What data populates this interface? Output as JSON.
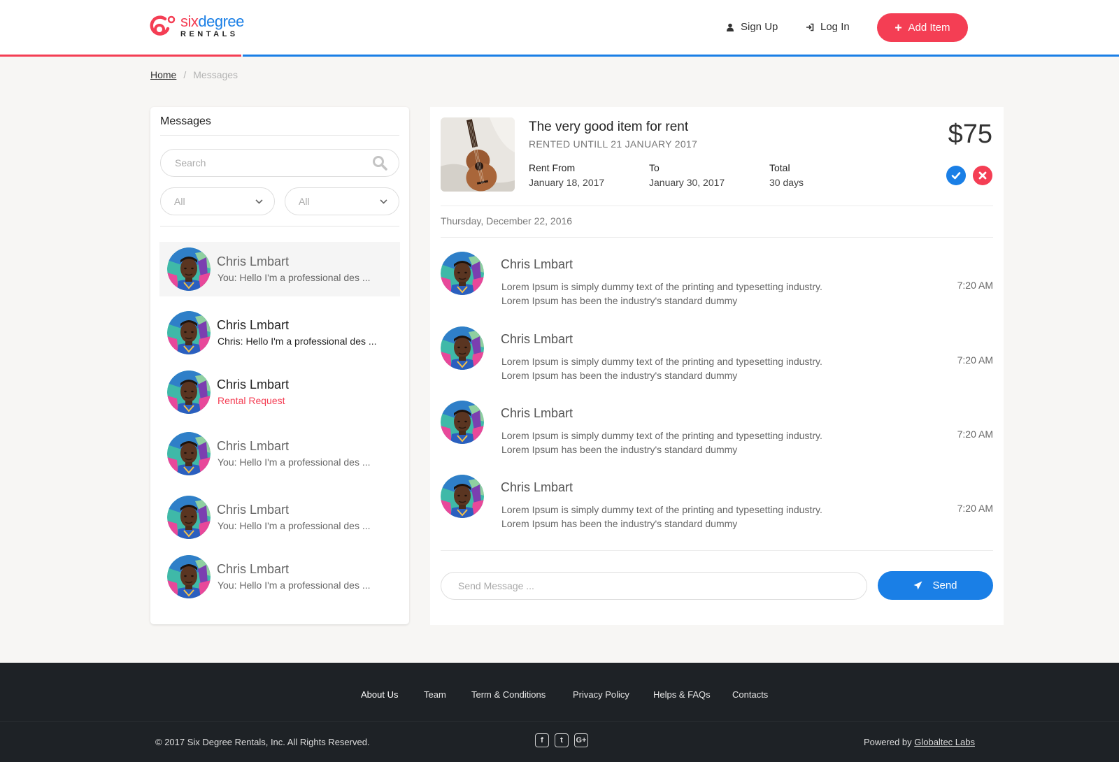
{
  "brand": {
    "six": "six",
    "degree": "degree",
    "rentals": "RENTALS"
  },
  "nav": {
    "signup": "Sign Up",
    "login": "Log In",
    "add_item": "Add Item"
  },
  "breadcrumb": {
    "home": "Home",
    "sep": "/",
    "current": "Messages"
  },
  "colors": {
    "accent_red": "#f43e54",
    "accent_blue": "#1a7fe6",
    "footer_bg": "#1e2226"
  },
  "sidebar": {
    "title": "Messages",
    "search_placeholder": "Search",
    "filter1": "All",
    "filter2": "All",
    "conversations": [
      {
        "name": "Chris Lmbart",
        "preview": "You: Hello I'm a professional des ...",
        "active": true
      },
      {
        "name": "Chris Lmbart",
        "preview": "Chris: Hello I'm a professional des ..."
      },
      {
        "name": "Chris Lmbart",
        "preview": "Rental Request",
        "highlight": true
      },
      {
        "name": "Chris Lmbart",
        "preview": "You: Hello I'm a professional des ..."
      },
      {
        "name": "Chris Lmbart",
        "preview": "You: Hello I'm a professional des ..."
      },
      {
        "name": "Chris Lmbart",
        "preview": "You: Hello I'm a professional des ..."
      }
    ]
  },
  "item": {
    "title": "The very good item for rent",
    "subtitle": "RENTED UNTILL 21 JANUARY 2017",
    "price": "$75",
    "rent_from_label": "Rent From",
    "rent_from": "January 18, 2017",
    "to_label": "To",
    "to": "January 30, 2017",
    "total_label": "Total",
    "total": "30 days"
  },
  "thread": {
    "date": "Thursday, December 22, 2016",
    "messages": [
      {
        "name": "Chris Lmbart",
        "text": "Lorem Ipsum is simply dummy text of the printing and typesetting industry. Lorem Ipsum has been the industry's standard dummy",
        "time": "7:20 AM"
      },
      {
        "name": "Chris Lmbart",
        "text": "Lorem Ipsum is simply dummy text of the printing and typesetting industry. Lorem Ipsum has been the industry's standard dummy",
        "time": "7:20 AM"
      },
      {
        "name": "Chris Lmbart",
        "text": "Lorem Ipsum is simply dummy text of the printing and typesetting industry. Lorem Ipsum has been the industry's standard dummy",
        "time": "7:20 AM"
      },
      {
        "name": "Chris Lmbart",
        "text": "Lorem Ipsum is simply dummy text of the printing and typesetting industry. Lorem Ipsum has been the industry's standard dummy",
        "time": "7:20 AM"
      }
    ],
    "send_placeholder": "Send Message ...",
    "send_label": "Send"
  },
  "footer": {
    "links": [
      "About Us",
      "Team",
      "Term & Conditions",
      "Privacy Policy",
      "Helps & FAQs",
      "Contacts"
    ],
    "copyright": "© 2017  Six Degree Rentals, Inc. All Rights Reserved.",
    "socials": [
      "facebook-icon",
      "twitter-icon",
      "google-plus-icon"
    ],
    "social_glyphs": [
      "f",
      "t",
      "G+"
    ],
    "powered_by": "Powered by",
    "powered_link": "Globaltec Labs"
  }
}
